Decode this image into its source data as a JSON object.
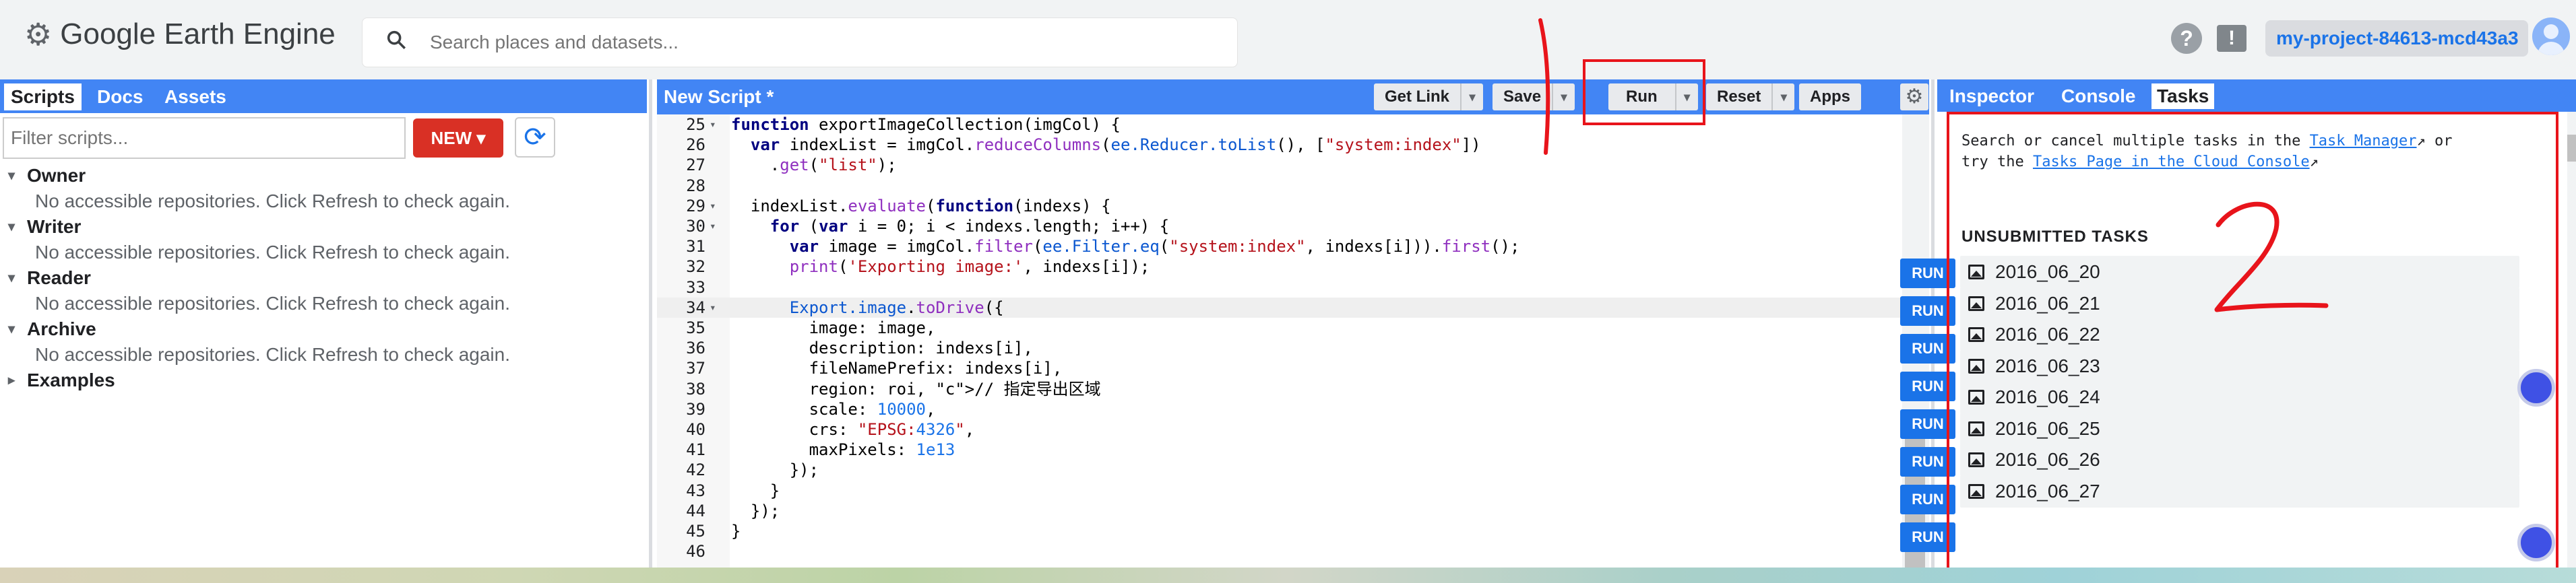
{
  "header": {
    "app_name": "Google Earth Engine",
    "search_placeholder": "Search places and datasets...",
    "help_icon": "?",
    "feedback_icon": "!",
    "project": "my-project-84613-mcd43a3"
  },
  "left_panel": {
    "tabs": [
      "Scripts",
      "Docs",
      "Assets"
    ],
    "filter_placeholder": "Filter scripts...",
    "new_button": "NEW",
    "groups": [
      {
        "title": "Owner",
        "message": "No accessible repositories. Click Refresh to check again."
      },
      {
        "title": "Writer",
        "message": "No accessible repositories. Click Refresh to check again."
      },
      {
        "title": "Reader",
        "message": "No accessible repositories. Click Refresh to check again."
      },
      {
        "title": "Archive",
        "message": "No accessible repositories. Click Refresh to check again."
      }
    ],
    "examples": "Examples"
  },
  "editor": {
    "title": "New Script *",
    "buttons": {
      "get_link": "Get Link",
      "save": "Save",
      "run": "Run",
      "reset": "Reset",
      "apps": "Apps"
    },
    "lines": [
      {
        "num": "25",
        "fold": true,
        "text": "function exportImageCollection(imgCol) {"
      },
      {
        "num": "26",
        "fold": false,
        "text": "  var indexList = imgCol.reduceColumns(ee.Reducer.toList(), [\"system:index\"])"
      },
      {
        "num": "27",
        "fold": false,
        "text": "    .get(\"list\");"
      },
      {
        "num": "28",
        "fold": false,
        "text": ""
      },
      {
        "num": "29",
        "fold": true,
        "text": "  indexList.evaluate(function(indexs) {"
      },
      {
        "num": "30",
        "fold": true,
        "text": "    for (var i = 0; i < indexs.length; i++) {"
      },
      {
        "num": "31",
        "fold": false,
        "text": "      var image = imgCol.filter(ee.Filter.eq(\"system:index\", indexs[i])).first();"
      },
      {
        "num": "32",
        "fold": false,
        "text": "      print('Exporting image:', indexs[i]);"
      },
      {
        "num": "33",
        "fold": false,
        "text": ""
      },
      {
        "num": "34",
        "fold": true,
        "text": "      Export.image.toDrive({"
      },
      {
        "num": "35",
        "fold": false,
        "text": "        image: image,"
      },
      {
        "num": "36",
        "fold": false,
        "text": "        description: indexs[i],"
      },
      {
        "num": "37",
        "fold": false,
        "text": "        fileNamePrefix: indexs[i],"
      },
      {
        "num": "38",
        "fold": false,
        "text": "        region: roi, // 指定导出区域"
      },
      {
        "num": "39",
        "fold": false,
        "text": "        scale: 10000,"
      },
      {
        "num": "40",
        "fold": false,
        "text": "        crs: \"EPSG:4326\","
      },
      {
        "num": "41",
        "fold": false,
        "text": "        maxPixels: 1e13"
      },
      {
        "num": "42",
        "fold": false,
        "text": "      });"
      },
      {
        "num": "43",
        "fold": false,
        "text": "    }"
      },
      {
        "num": "44",
        "fold": false,
        "text": "  });"
      },
      {
        "num": "45",
        "fold": false,
        "text": "}"
      },
      {
        "num": "46",
        "fold": false,
        "text": ""
      }
    ]
  },
  "right_panel": {
    "tabs": [
      "Inspector",
      "Console",
      "Tasks"
    ],
    "info_prefix": "Search or cancel multiple tasks in the ",
    "link_task_manager": "Task Manager",
    "info_middle": " or try the ",
    "link_tasks_page": "Tasks Page in the Cloud Console",
    "section_title": "UNSUBMITTED TASKS",
    "run_label": "RUN",
    "tasks": [
      "2016_06_20",
      "2016_06_21",
      "2016_06_22",
      "2016_06_23",
      "2016_06_24",
      "2016_06_25",
      "2016_06_26",
      "2016_06_27"
    ]
  },
  "annotations": {
    "label_1": "1",
    "label_2": "2",
    "color": "#e8141b"
  },
  "colors": {
    "panel_bar": "#4285f4",
    "new_button": "#d93025",
    "run_button": "#1a73e8"
  }
}
